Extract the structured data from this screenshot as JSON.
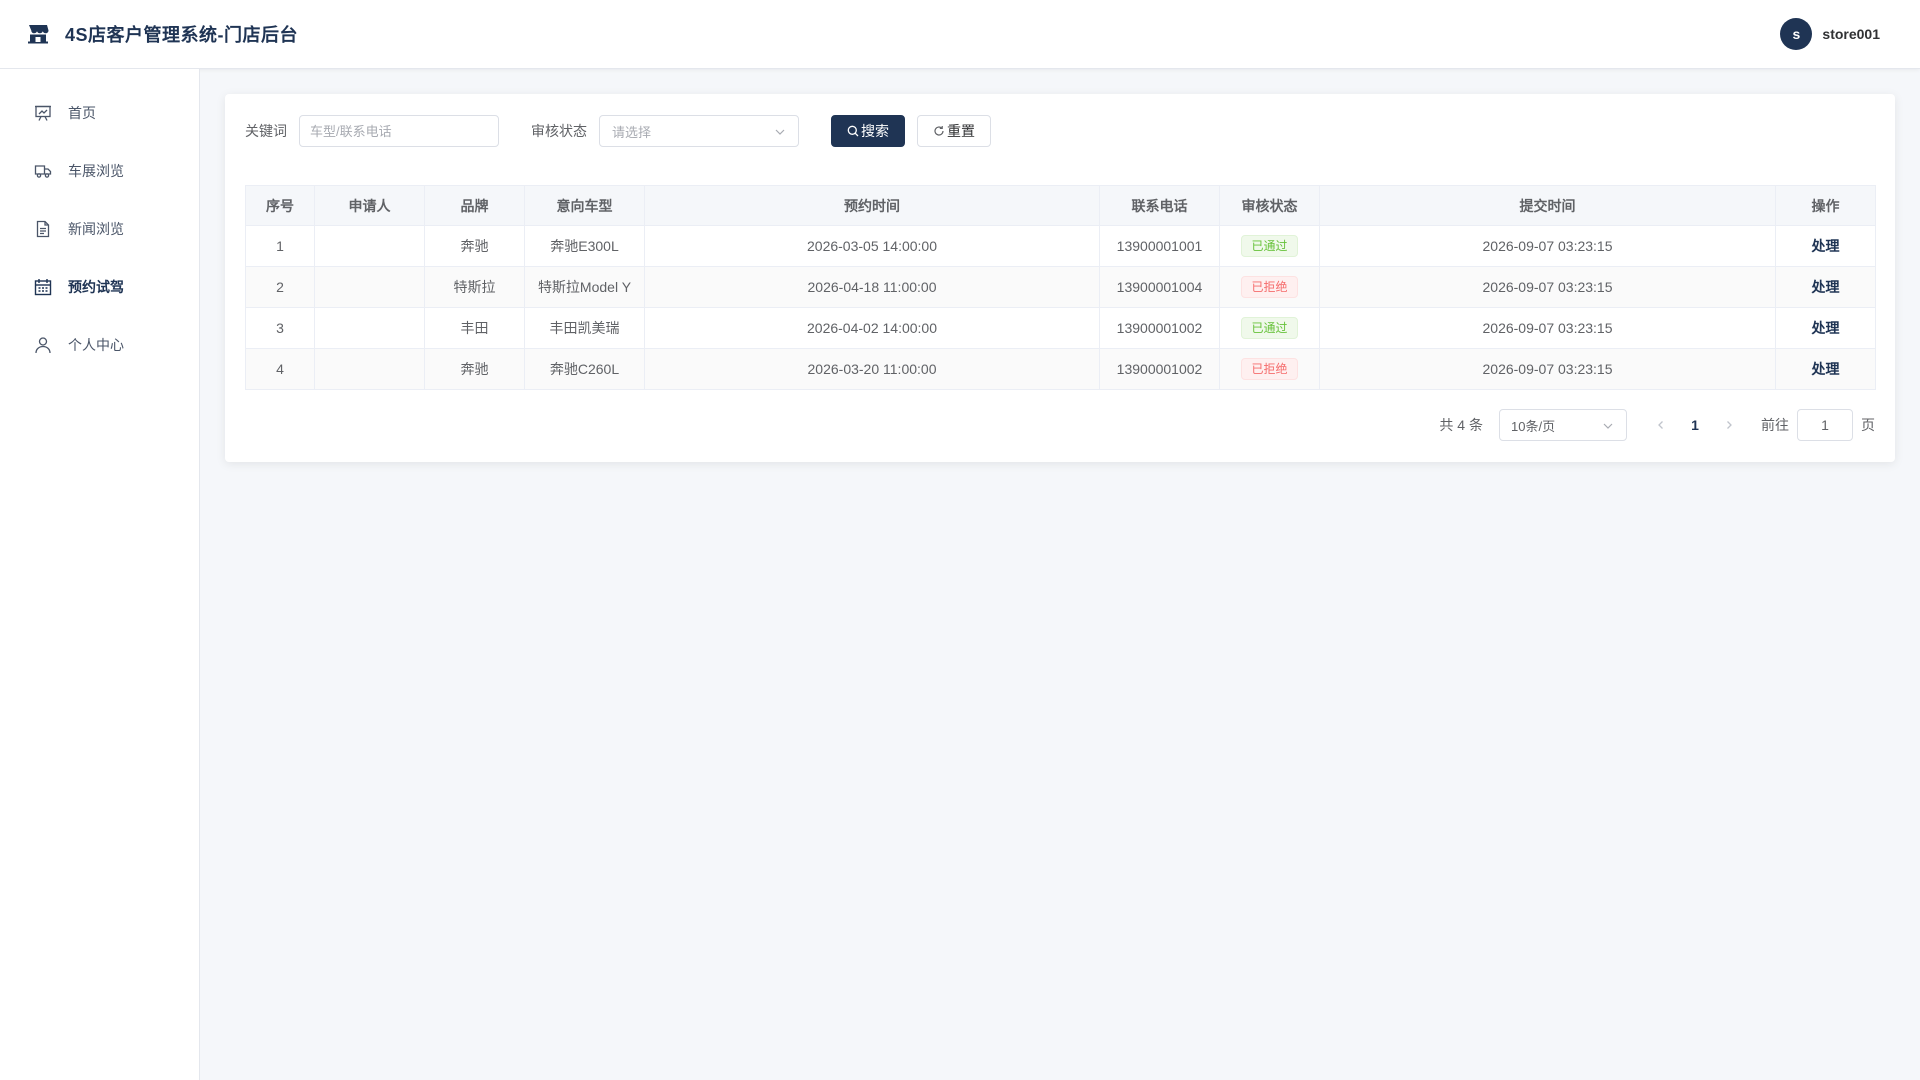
{
  "header": {
    "title": "4S店客户管理系统-门店后台",
    "logo_icon": "store-icon",
    "user": {
      "avatar_letter": "s",
      "username": "store001"
    }
  },
  "sidebar": {
    "items": [
      {
        "label": "首页",
        "icon": "dashboard-icon",
        "active": false
      },
      {
        "label": "车展浏览",
        "icon": "truck-icon",
        "active": false
      },
      {
        "label": "新闻浏览",
        "icon": "document-icon",
        "active": false
      },
      {
        "label": "预约试驾",
        "icon": "calendar-icon",
        "active": true
      },
      {
        "label": "个人中心",
        "icon": "user-icon",
        "active": false
      }
    ]
  },
  "filters": {
    "keyword_label": "关键词",
    "keyword_placeholder": "车型/联系电话",
    "keyword_value": "",
    "status_label": "审核状态",
    "status_placeholder": "请选择",
    "search_label": "搜索",
    "reset_label": "重置"
  },
  "table": {
    "columns": [
      "序号",
      "申请人",
      "品牌",
      "意向车型",
      "预约时间",
      "联系电话",
      "审核状态",
      "提交时间",
      "操作"
    ],
    "rows": [
      {
        "index": "1",
        "applicant": "",
        "brand": "奔驰",
        "model": "奔驰E300L",
        "appointment": "2026-03-05 14:00:00",
        "phone": "13900001001",
        "status": "已通过",
        "status_type": "pass",
        "submitted": "2026-09-07 03:23:15",
        "action": "处理"
      },
      {
        "index": "2",
        "applicant": "",
        "brand": "特斯拉",
        "model": "特斯拉Model Y",
        "appointment": "2026-04-18 11:00:00",
        "phone": "13900001004",
        "status": "已拒绝",
        "status_type": "reject",
        "submitted": "2026-09-07 03:23:15",
        "action": "处理"
      },
      {
        "index": "3",
        "applicant": "",
        "brand": "丰田",
        "model": "丰田凯美瑞",
        "appointment": "2026-04-02 14:00:00",
        "phone": "13900001002",
        "status": "已通过",
        "status_type": "pass",
        "submitted": "2026-09-07 03:23:15",
        "action": "处理"
      },
      {
        "index": "4",
        "applicant": "",
        "brand": "奔驰",
        "model": "奔驰C260L",
        "appointment": "2026-03-20 11:00:00",
        "phone": "13900001002",
        "status": "已拒绝",
        "status_type": "reject",
        "submitted": "2026-09-07 03:23:15",
        "action": "处理"
      }
    ]
  },
  "pagination": {
    "total_text": "共 4 条",
    "page_size": "10条/页",
    "current_page": "1",
    "goto_label": "前往",
    "goto_value": "1",
    "page_suffix": "页"
  },
  "colors": {
    "primary": "#1f3454",
    "pass": "#67c23a",
    "reject": "#f56c6c"
  }
}
